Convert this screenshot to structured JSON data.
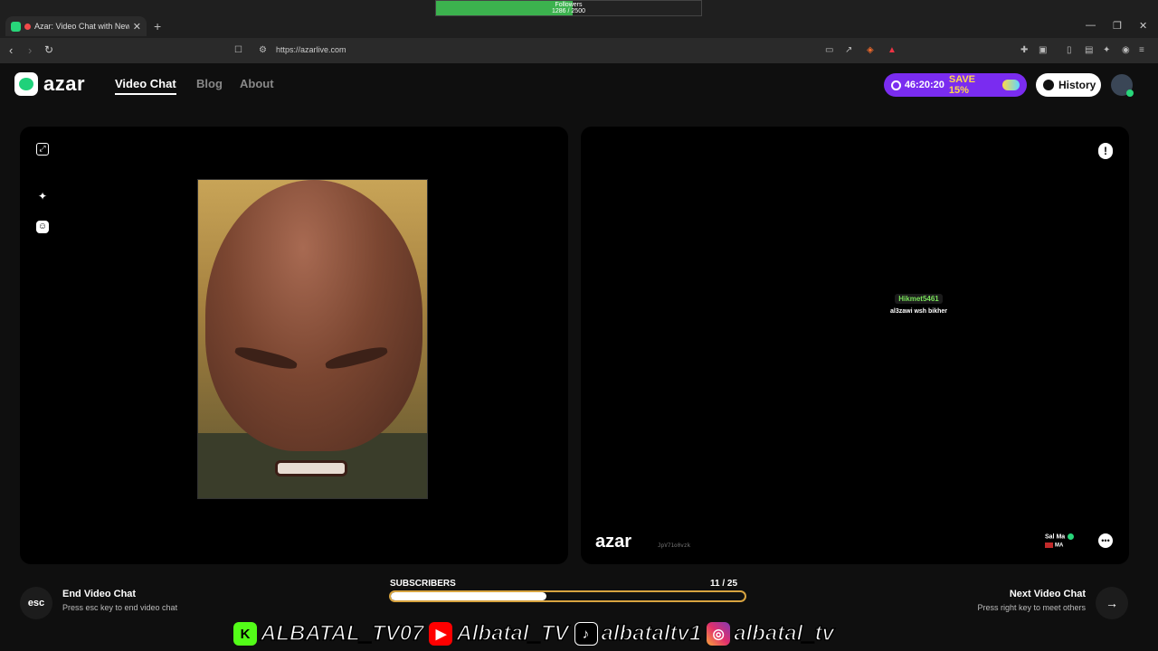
{
  "stream_overlay": {
    "followers_label": "Followers",
    "followers_count": "1286 / 2500",
    "followers_progress": 0.514
  },
  "browser": {
    "tab_title": "Azar: Video Chat with New Pe",
    "new_tab": "+",
    "url": "https://azarlive.com"
  },
  "header": {
    "logo_text": "azar",
    "nav": [
      "Video Chat",
      "Blog",
      "About"
    ],
    "active_nav": "Video Chat",
    "promo_timer": "46:20:20",
    "promo_save": "SAVE 15%",
    "history_label": "History"
  },
  "left_panel": {
    "icons": [
      "expand-icon",
      "magic-wand-icon",
      "face-filter-icon"
    ]
  },
  "right_panel": {
    "chat_username": "Hikmet5461",
    "chat_message": "al3zawi wsh bikher",
    "watermark_logo": "azar",
    "watermark_id": "JpV71o0vzk",
    "partner_name": "Sal Ma",
    "partner_country": "MA"
  },
  "footer": {
    "esc_label": "esc",
    "end_title": "End Video Chat",
    "end_subtitle": "Press esc key to end video chat",
    "next_title": "Next Video Chat",
    "next_subtitle": "Press right key to meet others",
    "next_arrow": "→"
  },
  "subscribers": {
    "label": "SUBSCRIBERS",
    "count": "11",
    "goal": "/ 25",
    "progress": 0.44
  },
  "social": {
    "kick": "ALBATAL_TV07",
    "youtube": "Albatal_TV",
    "tiktok": "albataltv1",
    "instagram": "albatal_tv"
  },
  "colors": {
    "accent_green": "#1fd17a",
    "promo_purple": "#7a2cf0",
    "progress_border": "#d8a440"
  }
}
